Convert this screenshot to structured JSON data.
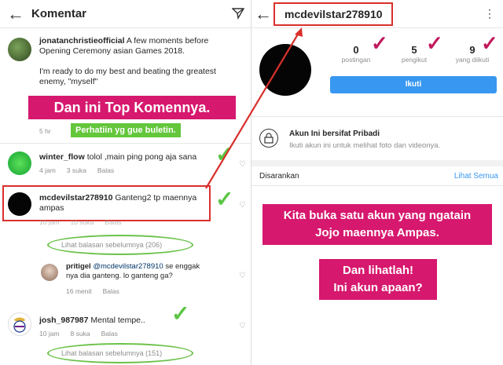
{
  "left": {
    "header": {
      "title": "Komentar",
      "back_icon": "arrow-left-icon",
      "send_icon": "send-icon"
    },
    "caption": {
      "username": "jonatanchristieofficial",
      "text_line1": "A few moments before",
      "text_line2": "Opening Ceremony asian Games 2018.",
      "text_line3": "I'm ready to do my best and beating the greatest",
      "text_line4": "enemy, \"myself\"",
      "time": "5 hr"
    },
    "top_banner": "Dan ini Top Komennya.",
    "green_banner": "Perhatiin yg gue buletin.",
    "comments": [
      {
        "username": "winter_flow",
        "text": "tolol ,main ping pong aja sana",
        "time": "4 jam",
        "likes": "3 suka",
        "reply": "Balas"
      },
      {
        "username": "mcdevilstar278910",
        "text_line1": "Ganteng2 tp maennya",
        "text_line2": "ampas",
        "time": "10 jam",
        "likes": "10 suka",
        "reply": "Balas"
      }
    ],
    "view_replies_1": "Lihat balasan sebelumnya (206)",
    "reply": {
      "username": "pritigel",
      "mention": "@mcdevilstar278910",
      "text_line1": "se enggak",
      "text_line2": "nya dia ganteng. lo ganteng ga?",
      "time": "16 menit",
      "reply": "Balas"
    },
    "comment3": {
      "username": "josh_987987",
      "text": "Mental tempe..",
      "time": "10 jam",
      "likes": "8 suka",
      "reply": "Balas"
    },
    "view_replies_2": "Lihat balasan sebelumnya (151)"
  },
  "right": {
    "header": {
      "username": "mcdevilstar278910",
      "menu_icon": "more-vertical-icon"
    },
    "stats": [
      {
        "value": "0",
        "label": "postingan"
      },
      {
        "value": "5",
        "label": "pengikut"
      },
      {
        "value": "9",
        "label": "yang diikuti"
      }
    ],
    "follow_button": "Ikuti",
    "private": {
      "title": "Akun Ini bersifat Pribadi",
      "subtitle": "Ikuti akun ini untuk melihat foto dan videonya."
    },
    "suggested": {
      "label": "Disarankan",
      "see_all": "Lihat Semua"
    },
    "banner1_line1": "Kita buka satu akun yang ngatain",
    "banner1_line2": "Jojo maennya Ampas.",
    "banner2_line1": "Dan lihatlah!",
    "banner2_line2": "Ini akun apaan?"
  },
  "colors": {
    "accent_pink": "#d6186e",
    "accent_green": "#63c63b",
    "link_blue": "#3897f0",
    "red_box": "#d9302c"
  }
}
